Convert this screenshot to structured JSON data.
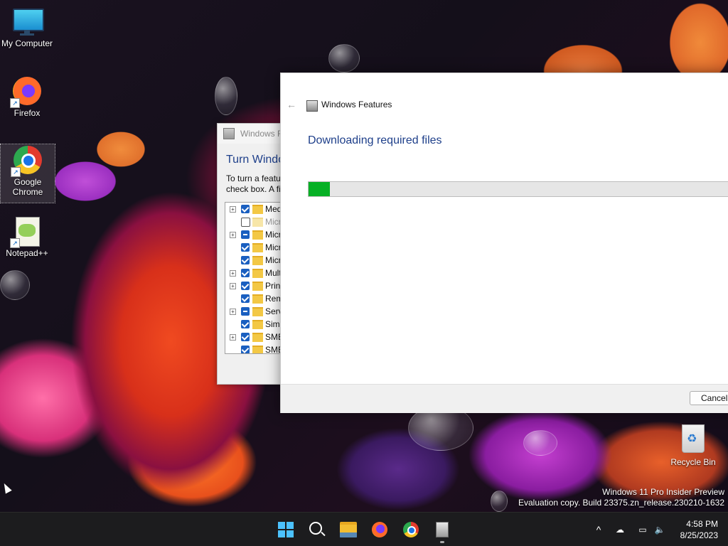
{
  "desktop": {
    "icons": [
      {
        "label": "My Computer",
        "icon": "computer-icon"
      },
      {
        "label": "Firefox",
        "icon": "firefox-icon"
      },
      {
        "label": "Google Chrome",
        "icon": "chrome-icon"
      },
      {
        "label": "Notepad++",
        "icon": "notepadpp-icon"
      }
    ],
    "recycle_bin": {
      "label": "Recycle Bin",
      "icon": "recycle-bin-icon"
    },
    "watermark": {
      "line1": "Windows 11 Pro Insider Preview",
      "line2": "Evaluation copy. Build 23375.zn_release.230210-1632"
    }
  },
  "back_window": {
    "title": "Windows Fe",
    "heading": "Turn Windo",
    "desc_line1": "To turn a featu",
    "desc_line2": "check box. A fi",
    "tree": [
      {
        "label": "Med",
        "state": "checked",
        "expandable": true
      },
      {
        "label": "Micr",
        "state": "empty",
        "expandable": false,
        "dim": true
      },
      {
        "label": "Micr",
        "state": "partial",
        "expandable": true
      },
      {
        "label": "Micr",
        "state": "checked",
        "expandable": false
      },
      {
        "label": "Micr",
        "state": "checked",
        "expandable": false
      },
      {
        "label": "Mult",
        "state": "checked",
        "expandable": true
      },
      {
        "label": "Print",
        "state": "checked",
        "expandable": true
      },
      {
        "label": "Rem",
        "state": "checked",
        "expandable": false
      },
      {
        "label": "Serv",
        "state": "partial",
        "expandable": true
      },
      {
        "label": "Simp",
        "state": "checked",
        "expandable": false
      },
      {
        "label": "SMB",
        "state": "checked",
        "expandable": true
      },
      {
        "label": "SMB",
        "state": "checked",
        "expandable": false
      }
    ]
  },
  "front_window": {
    "title": "Windows Features",
    "heading": "Downloading required files",
    "progress_fraction": 0.05,
    "cancel_label": "Cancel",
    "progress_color": "#06b025"
  },
  "taskbar": {
    "apps": [
      "start-icon",
      "search-icon",
      "file-explorer-icon",
      "firefox-icon",
      "chrome-icon",
      "windows-features-icon"
    ],
    "clock": {
      "time": "4:58 PM",
      "date": "8/25/2023"
    }
  }
}
